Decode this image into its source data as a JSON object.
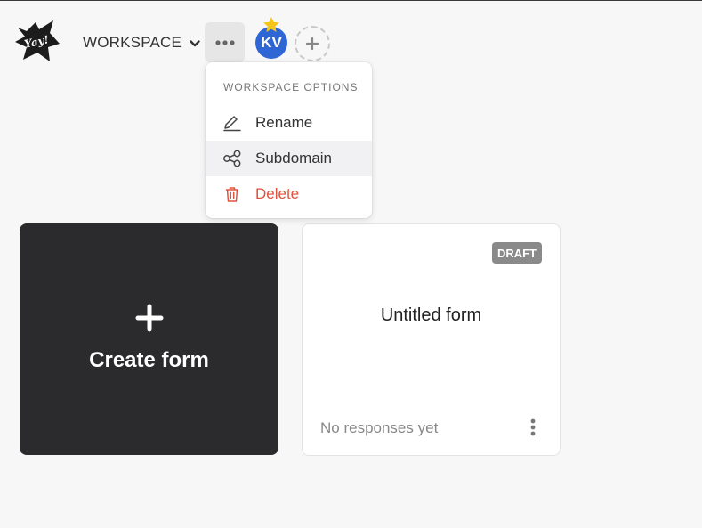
{
  "header": {
    "logo_text": "Yay!",
    "workspace_label": "WORKSPACE",
    "avatar_initials": "KV"
  },
  "workspace_menu": {
    "heading": "WORKSPACE OPTIONS",
    "items": [
      {
        "label": "Rename",
        "icon": "pencil-icon"
      },
      {
        "label": "Subdomain",
        "icon": "share-nodes-icon"
      },
      {
        "label": "Delete",
        "icon": "trash-icon"
      }
    ]
  },
  "create_card": {
    "label": "Create form"
  },
  "forms": [
    {
      "title": "Untitled form",
      "badge": "DRAFT",
      "status": "No responses yet"
    }
  ],
  "colors": {
    "create_card_bg": "#2b2b2d",
    "avatar_bg": "#2f66d6",
    "star": "#f5c518",
    "danger": "#e0533f",
    "badge_bg": "#8a8a8a"
  }
}
